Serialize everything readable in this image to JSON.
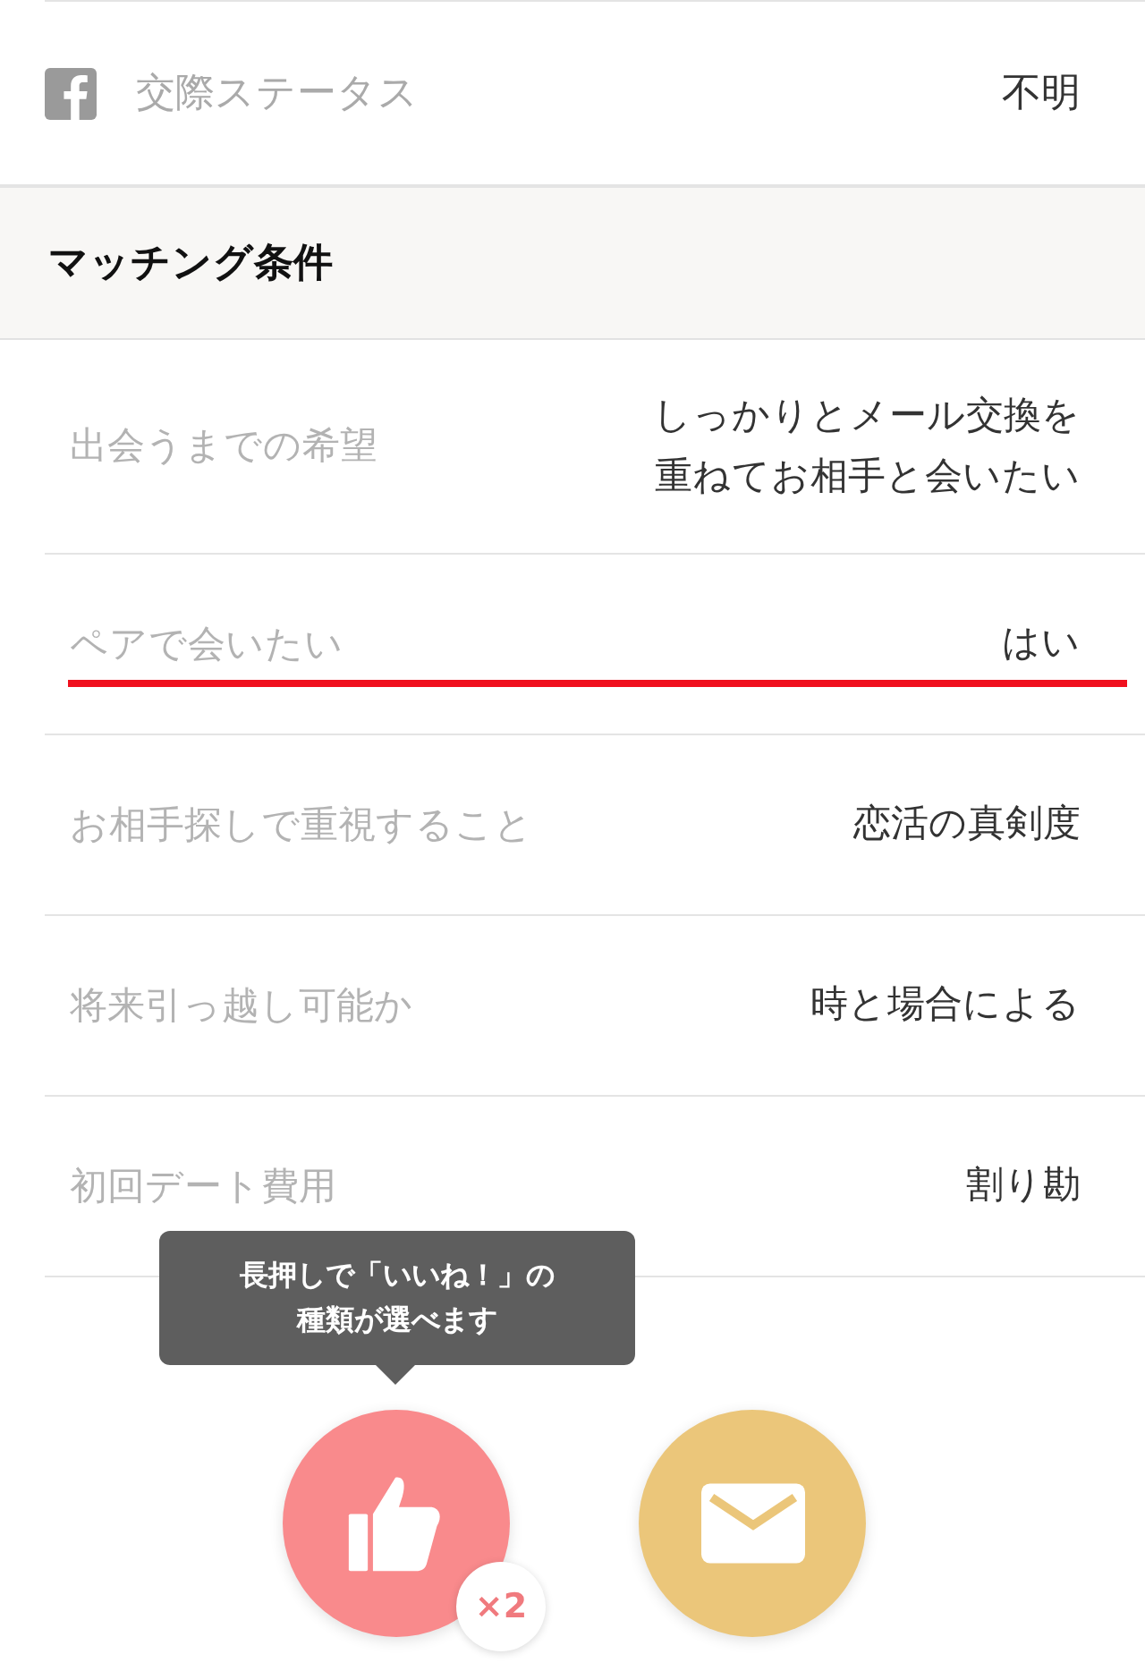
{
  "profile_rows": [
    {
      "label": "交際ステータス",
      "value": "不明",
      "kind": "facebook"
    }
  ],
  "section": {
    "title": "マッチング条件"
  },
  "rows": [
    {
      "label": "出会うまでの希望",
      "value_lines": [
        "しっかりとメール交換を",
        "重ねてお相手と会いたい"
      ],
      "highlighted": false
    },
    {
      "label": "ペアで会いたい",
      "value_lines": [
        "はい"
      ],
      "highlighted": true
    },
    {
      "label": "お相手探しで重視すること",
      "value_lines": [
        "恋活の真剣度"
      ],
      "highlighted": false
    },
    {
      "label": "将来引っ越し可能か",
      "value_lines": [
        "時と場合による"
      ],
      "highlighted": false
    },
    {
      "label": "初回デート費用",
      "value_lines": [
        "割り勘"
      ],
      "highlighted": false
    }
  ],
  "tooltip_lines": [
    "長押しで「いいね！」の",
    "種類が選べます"
  ],
  "like_button": {
    "badge": "×2"
  }
}
